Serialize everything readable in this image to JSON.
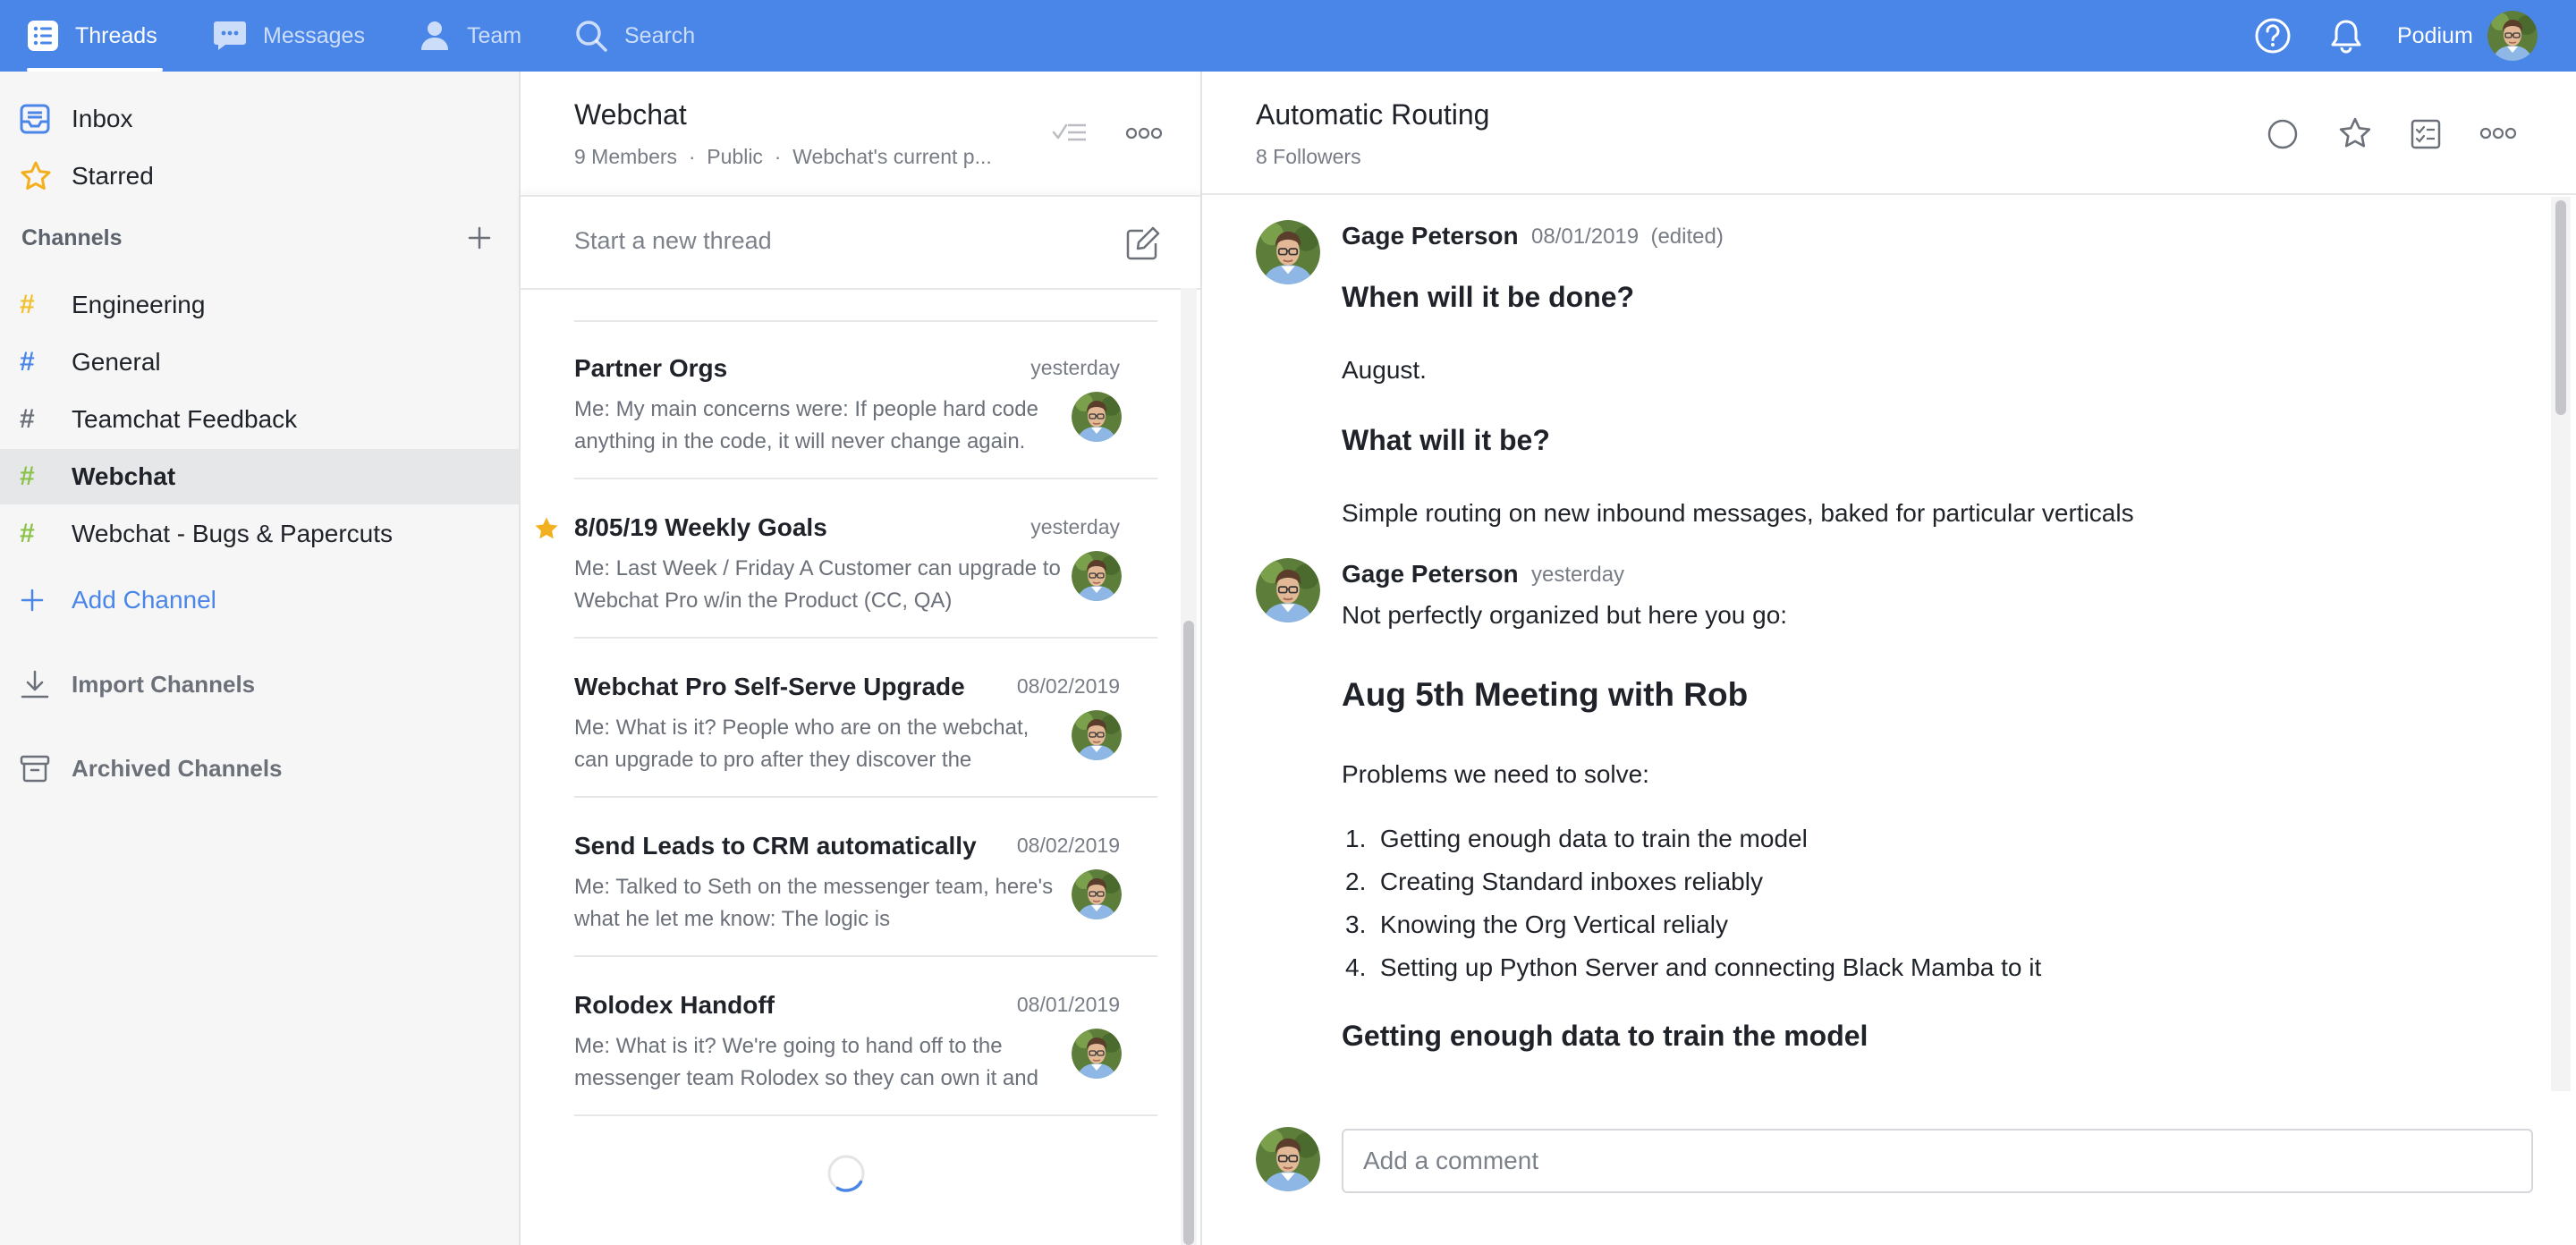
{
  "nav": {
    "tabs": [
      {
        "label": "Threads",
        "icon": "list-icon",
        "active": true
      },
      {
        "label": "Messages",
        "icon": "chat-bubble-icon",
        "active": false
      },
      {
        "label": "Team",
        "icon": "person-icon",
        "active": false
      }
    ],
    "search_label": "Search",
    "org_name": "Podium"
  },
  "sidebar": {
    "inbox": "Inbox",
    "starred": "Starred",
    "channels_title": "Channels",
    "channels": [
      {
        "label": "Engineering",
        "hash_color": "#f2c12e",
        "selected": false
      },
      {
        "label": "General",
        "hash_color": "#4a86e8",
        "selected": false
      },
      {
        "label": "Teamchat Feedback",
        "hash_color": "#6b7079",
        "selected": false
      },
      {
        "label": "Webchat",
        "hash_color": "#8bc34a",
        "selected": true
      },
      {
        "label": "Webchat - Bugs & Papercuts",
        "hash_color": "#8bc34a",
        "selected": false
      }
    ],
    "add_channel": "Add Channel",
    "import_channels": "Import Channels",
    "archived_channels": "Archived Channels"
  },
  "channel": {
    "title": "Webchat",
    "members": "9 Members",
    "visibility": "Public",
    "description": "Webchat's current p...",
    "new_thread_placeholder": "Start a new thread",
    "threads": [
      {
        "title": "Partner Orgs",
        "date": "yesterday",
        "snippet": "Me: My main concerns were: If people hard code anything in the code, it will never change again.",
        "starred": false
      },
      {
        "title": "8/05/19 Weekly Goals",
        "date": "yesterday",
        "snippet": "Me: Last Week / Friday A Customer can upgrade to Webchat Pro w/in the Product (CC, QA)",
        "starred": true
      },
      {
        "title": "Webchat Pro Self-Serve Upgrade",
        "date": "08/02/2019",
        "snippet": "Me: What is it? People who are on the webchat, can upgrade to pro after they discover the",
        "starred": false
      },
      {
        "title": "Send Leads to CRM automatically",
        "date": "08/02/2019",
        "snippet": "Me: Talked to Seth on the messenger team, here's what he let me know: The logic is",
        "starred": false
      },
      {
        "title": "Rolodex Handoff",
        "date": "08/01/2019",
        "snippet": "Me: What is it? We're going to hand off to the messenger team Rolodex so they can own it and",
        "starred": false
      }
    ]
  },
  "thread": {
    "title": "Automatic Routing",
    "followers": "8 Followers",
    "messages": [
      {
        "author": "Gage Peterson",
        "date": "08/01/2019",
        "edited": "(edited)",
        "h1": "When will it be done?",
        "p1": "August.",
        "h2": "What will it be?",
        "p2": "Simple routing on new inbound messages, baked for particular verticals"
      },
      {
        "author": "Gage Peterson",
        "date": "yesterday",
        "intro": "Not perfectly organized but here you go:",
        "heading": "Aug 5th Meeting with Rob",
        "problems": "Problems we need to solve:",
        "list": [
          "Getting enough data to train the model",
          "Creating Standard inboxes reliably",
          "Knowing the Org Vertical relialy",
          "Setting up Python Server and connecting Black Mamba to it"
        ],
        "subheading": "Getting enough data to train the model"
      }
    ],
    "comment_placeholder": "Add a comment"
  },
  "colors": {
    "brand": "#4a86e8",
    "star": "#f2b01e"
  }
}
